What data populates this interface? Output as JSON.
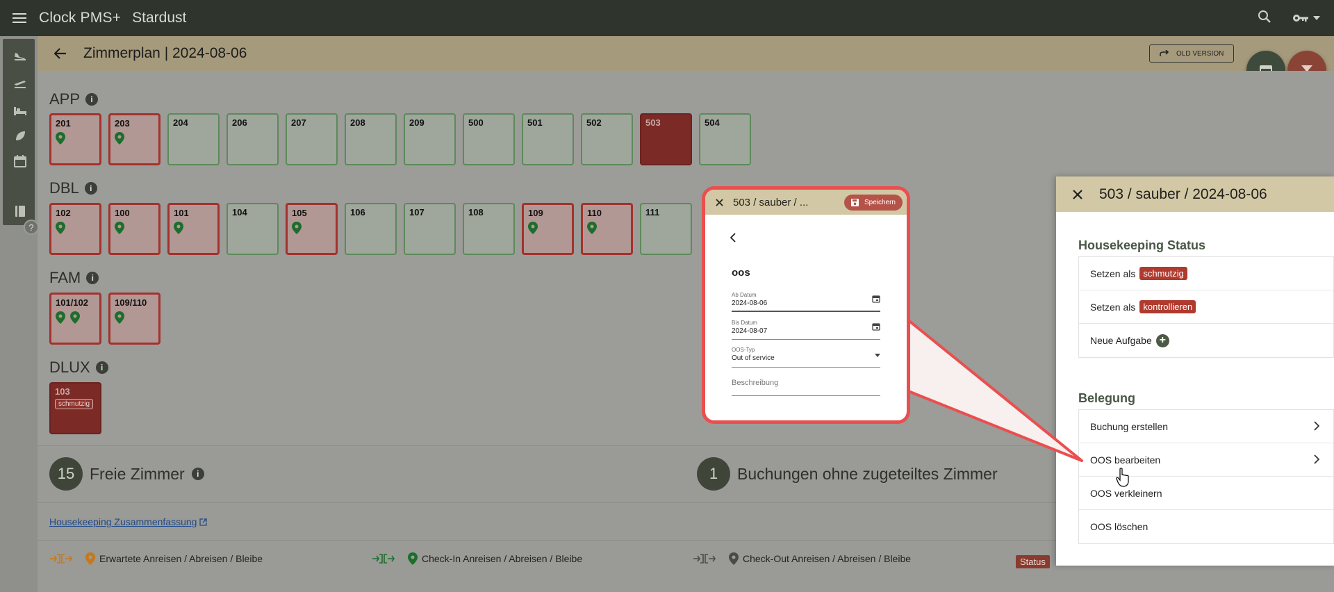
{
  "topbar": {
    "app_title": "Clock PMS+",
    "hotel": "Stardust"
  },
  "header": {
    "title": "Zimmerplan | 2024-08-06",
    "old_version": "OLD VERSION"
  },
  "categories": [
    {
      "label": "APP",
      "rooms": [
        {
          "num": "201",
          "state": "occ",
          "pins": 1
        },
        {
          "num": "203",
          "state": "occ",
          "pins": 1
        },
        {
          "num": "204",
          "state": "free"
        },
        {
          "num": "206",
          "state": "free"
        },
        {
          "num": "207",
          "state": "free"
        },
        {
          "num": "208",
          "state": "free"
        },
        {
          "num": "209",
          "state": "free"
        },
        {
          "num": "500",
          "state": "free"
        },
        {
          "num": "501",
          "state": "free"
        },
        {
          "num": "502",
          "state": "free"
        },
        {
          "num": "503",
          "state": "dark"
        },
        {
          "num": "504",
          "state": "free"
        }
      ]
    },
    {
      "label": "DBL",
      "rooms": [
        {
          "num": "102",
          "state": "occ",
          "pins": 1
        },
        {
          "num": "100",
          "state": "occ",
          "pins": 1
        },
        {
          "num": "101",
          "state": "occ",
          "pins": 1
        },
        {
          "num": "104",
          "state": "free"
        },
        {
          "num": "105",
          "state": "occ",
          "pins": 1
        },
        {
          "num": "106",
          "state": "free"
        },
        {
          "num": "107",
          "state": "free"
        },
        {
          "num": "108",
          "state": "free"
        },
        {
          "num": "109",
          "state": "occ",
          "pins": 1
        },
        {
          "num": "110",
          "state": "occ",
          "pins": 1
        },
        {
          "num": "111",
          "state": "free"
        }
      ]
    },
    {
      "label": "FAM",
      "rooms": [
        {
          "num": "101/102",
          "state": "occ",
          "pins": 2
        },
        {
          "num": "109/110",
          "state": "occ",
          "pins": 1
        }
      ]
    },
    {
      "label": "DLUX",
      "rooms": [
        {
          "num": "103",
          "state": "dark",
          "badge": "schmutzig"
        }
      ]
    }
  ],
  "stats": {
    "free_count": "15",
    "free_label": "Freie Zimmer",
    "unassigned_count": "1",
    "unassigned_label": "Buchungen ohne zugeteiltes Zimmer"
  },
  "hk_link": "Housekeeping Zusammenfassung",
  "legend": {
    "expected": "Erwartete Anreisen / Abreisen / Bleibe",
    "checkin": "Check-In Anreisen / Abreisen / Bleibe",
    "checkout": "Check-Out Anreisen / Abreisen / Bleibe",
    "status": "Status"
  },
  "panel": {
    "title": "503 / sauber / 2024-08-06",
    "hk_section": "Housekeeping Status",
    "set_as": "Setzen als",
    "dirty": "schmutzig",
    "inspect": "kontrollieren",
    "new_task": "Neue Aufgabe",
    "occupancy_section": "Belegung",
    "create_booking": "Buchung erstellen",
    "edit_oos": "OOS bearbeiten",
    "shrink_oos": "OOS verkleinern",
    "delete_oos": "OOS löschen"
  },
  "callout": {
    "title": "503 / sauber / ...",
    "save": "Speichern",
    "heading": "oos",
    "from_label": "Ab Datum",
    "from_value": "2024-08-06",
    "to_label": "Bis Datum",
    "to_value": "2024-08-07",
    "type_label": "OOS-Typ",
    "type_value": "Out of service",
    "desc_placeholder": "Beschreibung"
  },
  "colors": {
    "topbar": "#2f352c",
    "header": "#a69a7d",
    "accent_red": "#b03a2e",
    "callout_border": "#ea4f4f"
  }
}
